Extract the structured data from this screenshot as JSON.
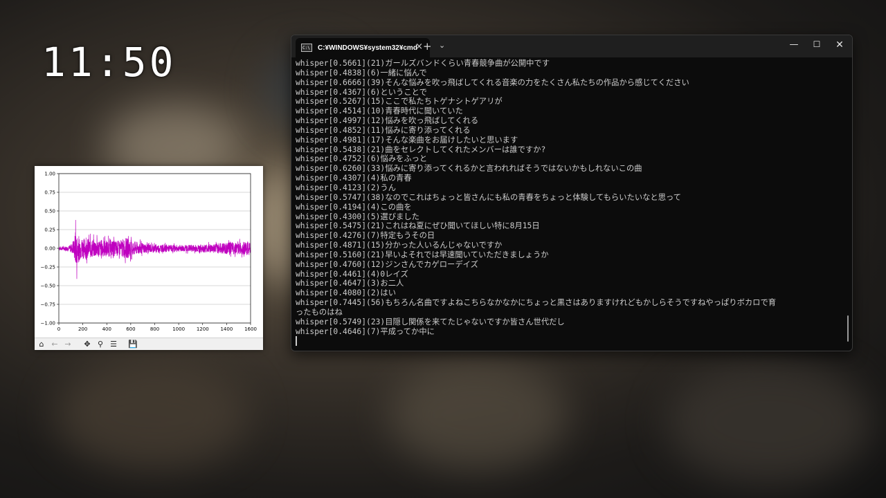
{
  "clock": "11:50",
  "terminal": {
    "tab_title": "C:¥WINDOWS¥system32¥cmd",
    "tab_icon_text": "C:\\",
    "new_tab": "+",
    "tab_dropdown": "⌄",
    "close_tab": "×",
    "minimize": "—",
    "maximize": "☐",
    "close": "✕",
    "lines": [
      "whisper[0.5661](21)ガールズバンドくらい青春競争曲が公開中です",
      "whisper[0.4838](6)一緒に悩んで",
      "whisper[0.6666](39)そんな悩みを吹っ飛ばしてくれる音楽の力をたくさん私たちの作品から感じてください",
      "whisper[0.4367](6)ということで",
      "whisper[0.5267](15)ここで私たちトゲナシトゲアリが",
      "whisper[0.4514](10)青春時代に聞いていた",
      "whisper[0.4997](12)悩みを吹っ飛ばしてくれる",
      "whisper[0.4852](11)悩みに寄り添ってくれる",
      "whisper[0.4981](17)そんな楽曲をお届けしたいと思います",
      "whisper[0.5438](21)曲をセレクトしてくれたメンバーは誰ですか?",
      "whisper[0.4752](6)悩みをふっと",
      "whisper[0.6260](33)悩みに寄り添ってくれるかと言われればそうではないかもしれないこの曲",
      "whisper[0.4307](4)私の青春",
      "whisper[0.4123](2)うん",
      "whisper[0.5747](38)なのでこれはちょっと皆さんにも私の青春をちょっと体験してもらいたいなと思って",
      "whisper[0.4194](4)この曲を",
      "whisper[0.4300](5)選びました",
      "whisper[0.5475](21)これはね夏にぜひ聞いてほしい特に8月15日",
      "whisper[0.4276](7)特定もうその日",
      "whisper[0.4871](15)分かった人いるんじゃないですか",
      "whisper[0.5160](21)早いよそれでは早速聞いていただきましょうか",
      "whisper[0.4760](12)ジンさんでカゲローデイズ",
      "whisper[0.4461](4)0レイズ",
      "whisper[0.4647](3)お二人",
      "whisper[0.4080](2)はい",
      "whisper[0.7445](56)もちろん名曲ですよねこちらなかなかにちょっと黒さはありますけれどもかしらそうですねやっぱりボカロで育",
      "ったものはね",
      "whisper[0.5749](23)目隠し関係を来てたじゃないですか皆さん世代だし",
      "whisper[0.4646](7)平成ってか中に"
    ]
  },
  "plot": {
    "toolbar_icons": [
      "home-icon",
      "back-arrow-icon",
      "forward-arrow-icon",
      "pan-icon",
      "zoom-icon",
      "configure-subplots-icon",
      "save-icon"
    ],
    "toolbar_glyphs": {
      "home": "⌂",
      "back": "←",
      "forward": "→",
      "pan": "✥",
      "zoom": "⚲",
      "configure": "☰",
      "save": "💾"
    },
    "line_color": "#bf00bf"
  },
  "chart_data": {
    "type": "line",
    "title": "",
    "xlabel": "",
    "ylabel": "",
    "xlim": [
      0,
      1600
    ],
    "ylim": [
      -1.0,
      1.0
    ],
    "xticks": [
      "0",
      "200",
      "400",
      "600",
      "800",
      "1000",
      "1200",
      "1400",
      "1600"
    ],
    "yticks": [
      "1.00",
      "0.75",
      "0.50",
      "0.25",
      "0.00",
      "−0.25",
      "−0.50",
      "−0.75",
      "−1.00"
    ],
    "grid": true,
    "series": [
      {
        "color": "#bf00bf",
        "envelope": [
          {
            "x": 0,
            "amp": 0.04
          },
          {
            "x": 80,
            "amp": 0.05
          },
          {
            "x": 120,
            "amp": 0.12
          },
          {
            "x": 140,
            "amp": 0.38
          },
          {
            "x": 180,
            "amp": 0.22
          },
          {
            "x": 260,
            "amp": 0.2
          },
          {
            "x": 360,
            "amp": 0.18
          },
          {
            "x": 440,
            "amp": 0.17
          },
          {
            "x": 500,
            "amp": 0.16
          },
          {
            "x": 560,
            "amp": 0.22
          },
          {
            "x": 640,
            "amp": 0.14
          },
          {
            "x": 720,
            "amp": 0.1
          },
          {
            "x": 820,
            "amp": 0.08
          },
          {
            "x": 1000,
            "amp": 0.07
          },
          {
            "x": 1200,
            "amp": 0.08
          },
          {
            "x": 1400,
            "amp": 0.12
          },
          {
            "x": 1600,
            "amp": 0.14
          }
        ]
      }
    ]
  }
}
